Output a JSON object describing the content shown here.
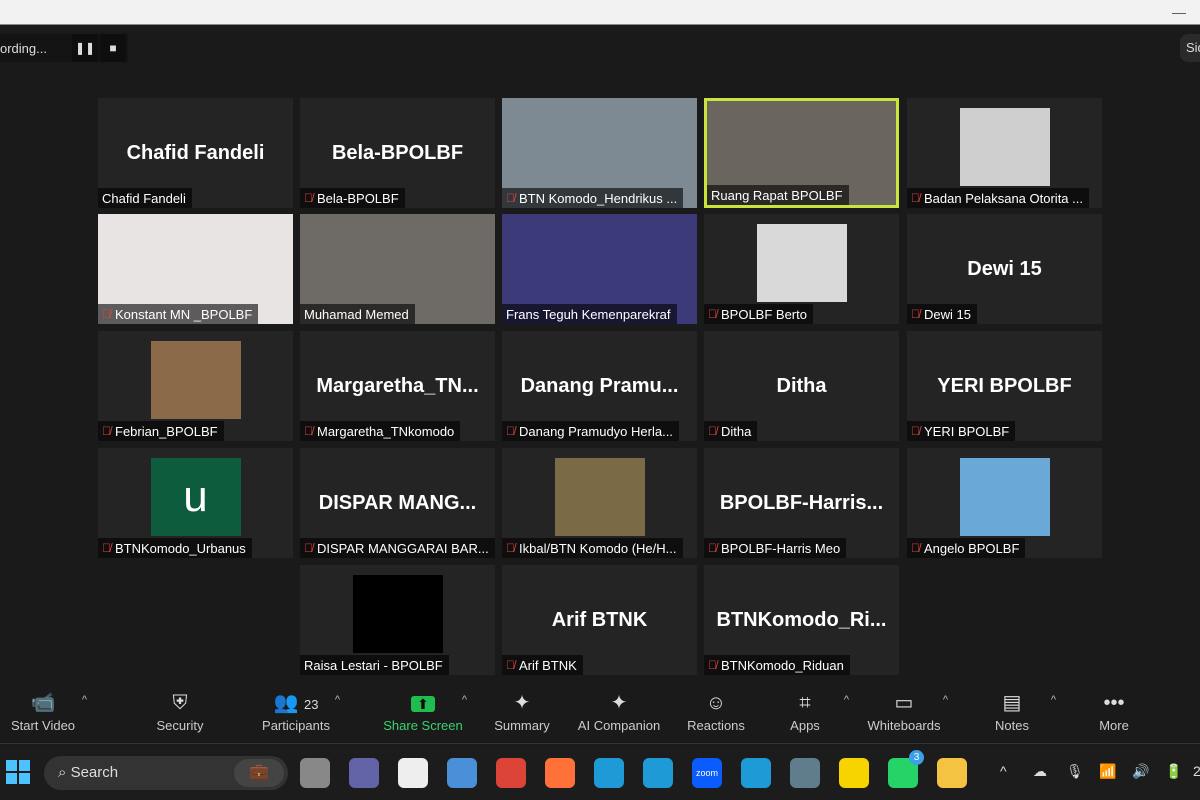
{
  "recording": {
    "label": "ording...",
    "pause_icon": "pause-icon",
    "stop_icon": "stop-icon"
  },
  "side_label": "Sid",
  "tiles": [
    {
      "name": "Chafid Fandeli",
      "big": "Chafid Fandeli",
      "muted": false,
      "type": "name"
    },
    {
      "name": "Bela-BPOLBF",
      "big": "Bela-BPOLBF",
      "muted": true,
      "type": "name"
    },
    {
      "name": "BTN Komodo_Hendrikus ...",
      "muted": true,
      "type": "video",
      "color": "#7d8a94"
    },
    {
      "name": "Ruang Rapat BPOLBF",
      "muted": false,
      "type": "video",
      "color": "#6b6560",
      "active": true
    },
    {
      "name": "Badan Pelaksana Otorita ...",
      "muted": true,
      "type": "avatar",
      "color": "#cfcfcf"
    },
    {
      "name": "Konstant MN _BPOLBF",
      "muted": true,
      "type": "video",
      "color": "#e9e4e4"
    },
    {
      "name": "Muhamad Memed",
      "muted": false,
      "type": "video",
      "color": "#6e6a66"
    },
    {
      "name": "Frans Teguh Kemenparekraf",
      "muted": false,
      "type": "video",
      "color": "#3d3a7a"
    },
    {
      "name": "BPOLBF Berto",
      "muted": true,
      "type": "avatar",
      "color": "#d9d9d9"
    },
    {
      "name": "Dewi 15",
      "big": "Dewi 15",
      "muted": true,
      "type": "name"
    },
    {
      "name": "Febrian_BPOLBF",
      "muted": true,
      "type": "avatar",
      "color": "#8a6a48"
    },
    {
      "name": "Margaretha_TNkomodo",
      "big": "Margaretha_TN...",
      "muted": true,
      "type": "name"
    },
    {
      "name": "Danang Pramudyo Herla...",
      "big": "Danang  Pramu...",
      "muted": true,
      "type": "name"
    },
    {
      "name": "Ditha",
      "big": "Ditha",
      "muted": true,
      "type": "name"
    },
    {
      "name": "YERI BPOLBF",
      "big": "YERI BPOLBF",
      "muted": true,
      "type": "name"
    },
    {
      "name": "BTNKomodo_Urbanus",
      "muted": true,
      "type": "letter",
      "letter": "u",
      "color": "#0d5c3e"
    },
    {
      "name": "DISPAR MANGGARAI BAR...",
      "big": "DISPAR  MANG...",
      "muted": true,
      "type": "name"
    },
    {
      "name": "Ikbal/BTN Komodo (He/H...",
      "muted": true,
      "type": "avatar",
      "color": "#7a6a45"
    },
    {
      "name": "BPOLBF-Harris Meo",
      "big": "BPOLBF-Harris...",
      "muted": true,
      "type": "name"
    },
    {
      "name": "Angelo BPOLBF",
      "muted": true,
      "type": "avatar",
      "color": "#6aa8d8"
    },
    {
      "name": "Raisa Lestari - BPOLBF",
      "muted": false,
      "type": "avatar",
      "color": "#000000",
      "col": 1
    },
    {
      "name": "Arif BTNK",
      "big": "Arif BTNK",
      "muted": true,
      "type": "name"
    },
    {
      "name": "BTNKomodo_Riduan",
      "big": "BTNKomodo_Ri...",
      "muted": true,
      "type": "name"
    }
  ],
  "toolbar": [
    {
      "label": "Start Video",
      "icon": "video-off-icon",
      "glyph": "📹",
      "caret": true
    },
    {
      "label": "Security",
      "icon": "shield-icon",
      "glyph": "⛨"
    },
    {
      "label": "Participants",
      "icon": "participants-icon",
      "glyph": "👥",
      "count": "23",
      "caret": true
    },
    {
      "label": "Share Screen",
      "icon": "share-screen-icon",
      "glyph": "⬆",
      "caret": true,
      "green": true
    },
    {
      "label": "Summary",
      "icon": "summary-icon",
      "glyph": "✦"
    },
    {
      "label": "AI Companion",
      "icon": "ai-companion-icon",
      "glyph": "✦"
    },
    {
      "label": "Reactions",
      "icon": "reactions-icon",
      "glyph": "☺"
    },
    {
      "label": "Apps",
      "icon": "apps-icon",
      "glyph": "⌗",
      "caret": true
    },
    {
      "label": "Whiteboards",
      "icon": "whiteboard-icon",
      "glyph": "▭",
      "caret": true
    },
    {
      "label": "Notes",
      "icon": "notes-icon",
      "glyph": "▤",
      "caret": true
    },
    {
      "label": "More",
      "icon": "more-icon",
      "glyph": "•••"
    }
  ],
  "taskbar": {
    "search_placeholder": "Search",
    "apps": [
      {
        "name": "task-view",
        "color": "#888"
      },
      {
        "name": "teams",
        "color": "#6264a7"
      },
      {
        "name": "store",
        "color": "#eee"
      },
      {
        "name": "notepad",
        "color": "#4a90d9"
      },
      {
        "name": "chrome",
        "color": "#db4437"
      },
      {
        "name": "firefox",
        "color": "#ff7139"
      },
      {
        "name": "edge",
        "color": "#1e9bd7"
      },
      {
        "name": "edge-profile",
        "color": "#1e9bd7"
      },
      {
        "name": "zoom",
        "color": "#0b5cff",
        "label": "zoom"
      },
      {
        "name": "edge-work",
        "color": "#1e9bd7"
      },
      {
        "name": "calculator",
        "color": "#607d8b"
      },
      {
        "name": "sticky-notes",
        "color": "#f7d400"
      },
      {
        "name": "whatsapp",
        "color": "#25d366",
        "badge": "3"
      },
      {
        "name": "file-explorer",
        "color": "#f5c342"
      }
    ],
    "tray": [
      "^",
      "☁",
      "🎙",
      "📶",
      "🔊",
      "🔋"
    ],
    "clock": "2"
  }
}
